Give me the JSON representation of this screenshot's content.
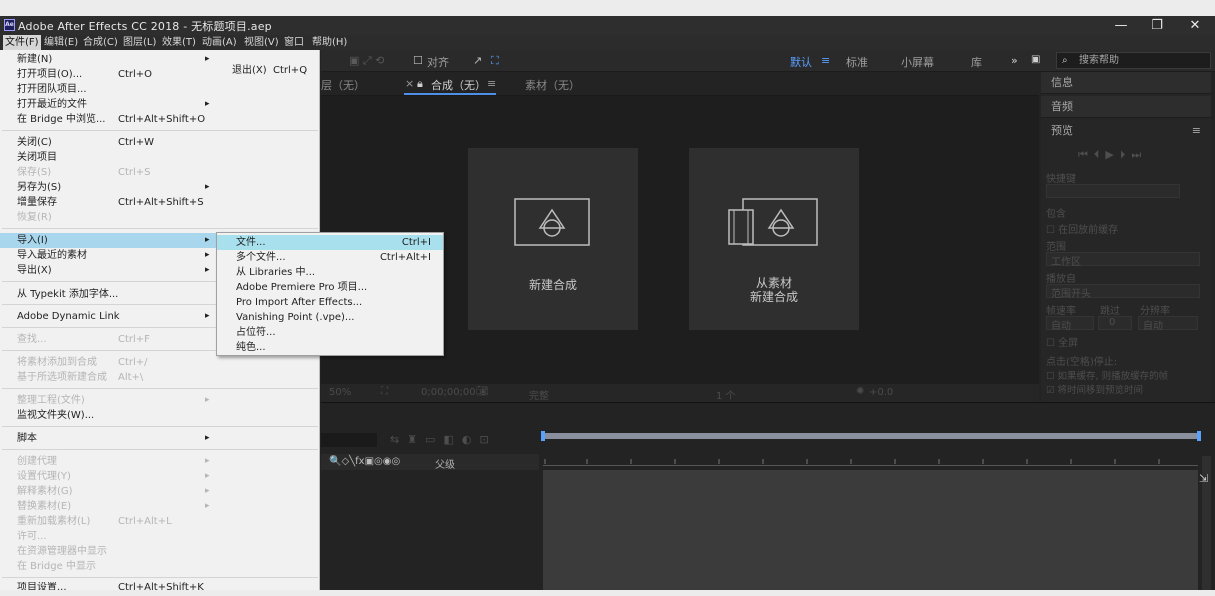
{
  "window": {
    "logo_text": "Ae",
    "title": "Adobe After Effects CC 2018 - 无标题项目.aep",
    "controls": {
      "minimize": "—",
      "maximize": "❐",
      "close": "✕"
    }
  },
  "menubar": [
    {
      "label": "文件(F)",
      "active": true
    },
    {
      "label": "编辑(E)"
    },
    {
      "label": "合成(C)"
    },
    {
      "label": "图层(L)"
    },
    {
      "label": "效果(T)"
    },
    {
      "label": "动画(A)"
    },
    {
      "label": "视图(V)"
    },
    {
      "label": "窗口"
    },
    {
      "label": "帮助(H)"
    }
  ],
  "toolbar": {
    "align_label": "对齐",
    "workspaces": [
      "默认",
      "标准",
      "小屏幕",
      "库"
    ],
    "active_workspace": "默认",
    "more": "»",
    "search_placeholder": "搜索帮助"
  },
  "file_menu": {
    "exit_label": "退出(X)",
    "exit_shortcut": "Ctrl+Q",
    "items": [
      {
        "label": "新建(N)",
        "arrow": "▸"
      },
      {
        "label": "打开项目(O)...",
        "shortcut": "Ctrl+O"
      },
      {
        "label": "打开团队项目..."
      },
      {
        "label": "打开最近的文件",
        "arrow": "▸"
      },
      {
        "label": "在 Bridge 中浏览...",
        "shortcut": "Ctrl+Alt+Shift+O"
      },
      {
        "label": "关闭(C)",
        "shortcut": "Ctrl+W"
      },
      {
        "label": "关闭项目"
      },
      {
        "label": "保存(S)",
        "shortcut": "Ctrl+S",
        "disabled": true
      },
      {
        "label": "另存为(S)",
        "arrow": "▸"
      },
      {
        "label": "增量保存",
        "shortcut": "Ctrl+Alt+Shift+S"
      },
      {
        "label": "恢复(R)",
        "disabled": true
      },
      {
        "label": "导入(I)",
        "arrow": "▸",
        "highlight": true
      },
      {
        "label": "导入最近的素材",
        "arrow": "▸"
      },
      {
        "label": "导出(X)",
        "arrow": "▸"
      },
      {
        "label": "从 Typekit 添加字体..."
      },
      {
        "label": "Adobe Dynamic Link",
        "arrow": "▸"
      },
      {
        "label": "查找...",
        "shortcut": "Ctrl+F",
        "disabled": true
      },
      {
        "label": "将素材添加到合成",
        "shortcut": "Ctrl+/",
        "disabled": true
      },
      {
        "label": "基于所选项新建合成",
        "shortcut": "Alt+\\",
        "disabled": true
      },
      {
        "label": "整理工程(文件)",
        "arrow": "▸",
        "disabled": true
      },
      {
        "label": "监视文件夹(W)..."
      },
      {
        "label": "脚本",
        "arrow": "▸"
      },
      {
        "label": "创建代理",
        "arrow": "▸",
        "disabled": true
      },
      {
        "label": "设置代理(Y)",
        "arrow": "▸",
        "disabled": true
      },
      {
        "label": "解释素材(G)",
        "arrow": "▸",
        "disabled": true
      },
      {
        "label": "替换素材(E)",
        "arrow": "▸",
        "disabled": true
      },
      {
        "label": "重新加载素材(L)",
        "shortcut": "Ctrl+Alt+L",
        "disabled": true
      },
      {
        "label": "许可...",
        "disabled": true
      },
      {
        "label": "在资源管理器中显示",
        "disabled": true
      },
      {
        "label": "在 Bridge 中显示",
        "disabled": true
      },
      {
        "label": "项目设置...",
        "shortcut": "Ctrl+Alt+Shift+K"
      }
    ]
  },
  "import_submenu": [
    {
      "label": "文件...",
      "shortcut": "Ctrl+I",
      "highlight": true
    },
    {
      "label": "多个文件...",
      "shortcut": "Ctrl+Alt+I"
    },
    {
      "label": "从 Libraries 中..."
    },
    {
      "label": "Adobe Premiere Pro 项目..."
    },
    {
      "label": "Pro Import After Effects..."
    },
    {
      "label": "Vanishing Point (.vpe)..."
    },
    {
      "label": "占位符..."
    },
    {
      "label": "纯色..."
    }
  ],
  "panels": {
    "tab_layer": "层（无）",
    "tab_comp": "合成（无）",
    "tab_footage": "素材（无）"
  },
  "composition": {
    "new_comp_label": "新建合成",
    "from_footage_line1": "从素材",
    "from_footage_line2": "新建合成"
  },
  "viewer": {
    "zoom": "50%",
    "timecode": "0;00;00;00",
    "quality": "完整",
    "view": "1 个",
    "exposure": "+0.0"
  },
  "right_panel": {
    "info": "信息",
    "audio": "音频",
    "preview": "预览",
    "preview_controls": [
      "⏮",
      "⏴",
      "▶",
      "⏵",
      "⏭"
    ],
    "shortcut_label": "快捷键",
    "include_label": "包含",
    "loop_option": "在回放前缓存",
    "range_label": "范围",
    "range_value": "工作区",
    "play_from_label": "播放自",
    "play_from_value": "范围开头",
    "frame_rate_label": "帧速率",
    "skip_label": "跳过",
    "resolution_label": "分辨率",
    "frame_rate_value": "自动",
    "skip_value": "0",
    "resolution_value": "自动",
    "fullscreen": "全屏",
    "stop_label": "点击(空格)停止:",
    "stop_opt1": "如果缓存, 则播放缓存的帧",
    "stop_opt2": "将时间移到预览时间"
  },
  "timeline": {
    "parent_label": "父级",
    "column_icons": "🔍◇╲fx▣◎◉◎"
  }
}
